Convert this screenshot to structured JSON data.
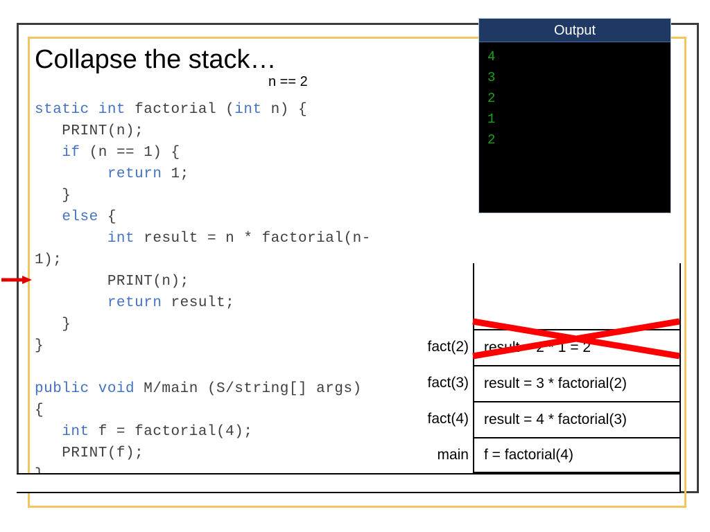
{
  "slide": {
    "title": "Collapse the stack…",
    "annotation": "n == 2"
  },
  "colors": {
    "keyword": "#4472c4",
    "code_text": "#3f3f3f",
    "console_title_bg": "#1f3864",
    "console_text": "#19a319",
    "strike": "#ff0000",
    "frame_dark": "#3d3d3d",
    "frame_gold": "#f2c75c"
  },
  "code": {
    "lines": [
      [
        {
          "t": "static int",
          "c": "kw"
        },
        {
          "t": " factorial (",
          "c": "pl"
        },
        {
          "t": "int",
          "c": "kw"
        },
        {
          "t": " n) {",
          "c": "pl"
        }
      ],
      [
        {
          "t": "   PRINT(n);",
          "c": "pl"
        }
      ],
      [
        {
          "t": "   ",
          "c": "pl"
        },
        {
          "t": "if",
          "c": "kw"
        },
        {
          "t": " (n == 1) {",
          "c": "pl"
        }
      ],
      [
        {
          "t": "        ",
          "c": "pl"
        },
        {
          "t": "return",
          "c": "kw"
        },
        {
          "t": " 1;",
          "c": "pl"
        }
      ],
      [
        {
          "t": "   }",
          "c": "pl"
        }
      ],
      [
        {
          "t": "   ",
          "c": "pl"
        },
        {
          "t": "else",
          "c": "kw"
        },
        {
          "t": " {",
          "c": "pl"
        }
      ],
      [
        {
          "t": "        ",
          "c": "pl"
        },
        {
          "t": "int",
          "c": "kw"
        },
        {
          "t": " result = n * factorial(n-",
          "c": "pl"
        }
      ],
      [
        {
          "t": "1);",
          "c": "pl"
        }
      ],
      [
        {
          "t": "        PRINT(n);",
          "c": "pl"
        }
      ],
      [
        {
          "t": "        ",
          "c": "pl"
        },
        {
          "t": "return",
          "c": "kw"
        },
        {
          "t": " result;",
          "c": "pl"
        }
      ],
      [
        {
          "t": "   }",
          "c": "pl"
        }
      ],
      [
        {
          "t": "}",
          "c": "pl"
        }
      ],
      [
        {
          "t": "",
          "c": "pl"
        }
      ],
      [
        {
          "t": "public void",
          "c": "kw"
        },
        {
          "t": " M/main (S/string[] args)",
          "c": "pl"
        }
      ],
      [
        {
          "t": "{",
          "c": "pl"
        }
      ],
      [
        {
          "t": "   ",
          "c": "pl"
        },
        {
          "t": "int",
          "c": "kw"
        },
        {
          "t": " f = factorial(4);",
          "c": "pl"
        }
      ],
      [
        {
          "t": "   PRINT(f);",
          "c": "pl"
        }
      ],
      [
        {
          "t": "}",
          "c": "pl"
        }
      ]
    ]
  },
  "console": {
    "title": "Output",
    "lines": [
      "4",
      "3",
      "2",
      "1",
      "2"
    ]
  },
  "stack": {
    "rows": [
      {
        "label": "fact(2)",
        "value": "result = 2 * 1 = 2",
        "struck": true
      },
      {
        "label": "fact(3)",
        "value": "result = 3 * factorial(2)",
        "struck": false
      },
      {
        "label": "fact(4)",
        "value": "result = 4 * factorial(3)",
        "struck": false
      },
      {
        "label": "main",
        "value": "f = factorial(4)",
        "struck": false
      }
    ]
  }
}
